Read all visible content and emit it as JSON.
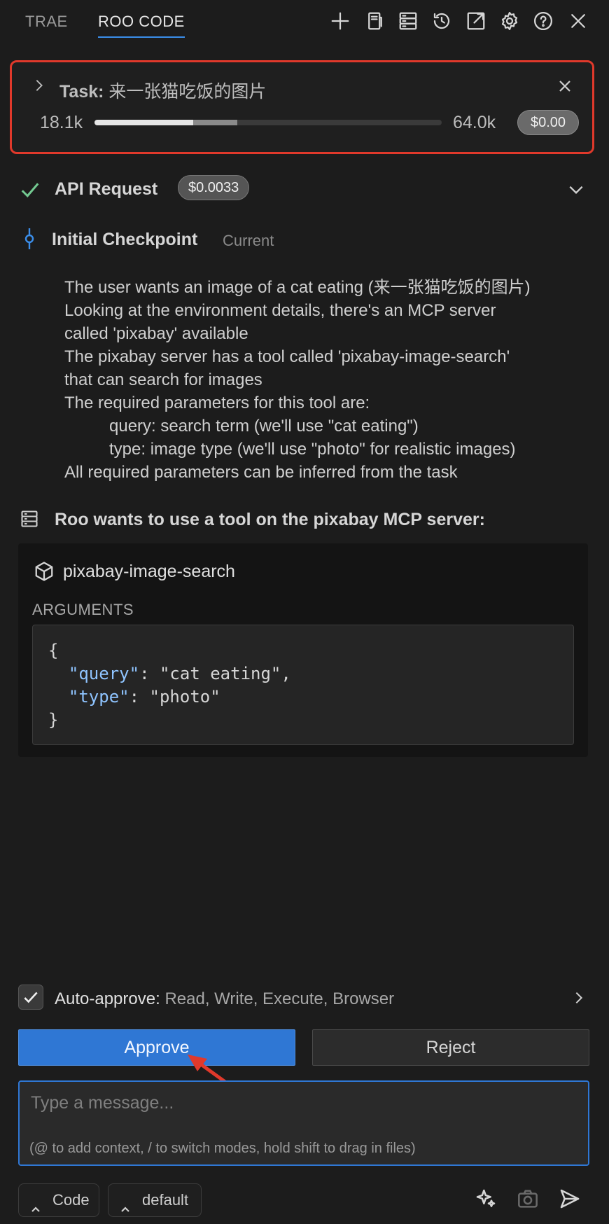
{
  "header": {
    "tabs": [
      {
        "label": "TRAE",
        "active": false
      },
      {
        "label": "ROO CODE",
        "active": true
      }
    ],
    "actions": [
      "plus-icon",
      "bookmark-icon",
      "server-icon",
      "history-icon",
      "external-link-icon",
      "gear-icon",
      "help-icon",
      "close-icon"
    ]
  },
  "task": {
    "prefix": "Task:",
    "title": "来一张猫吃饭的图片",
    "context_used": "18.1k",
    "context_max": "64.0k",
    "cost": "$0.00"
  },
  "api_request": {
    "label": "API Request",
    "cost": "$0.0033",
    "status_color": "#73c991"
  },
  "checkpoint": {
    "label": "Initial Checkpoint",
    "state": "Current"
  },
  "reasoning": {
    "lines": [
      {
        "text": "The user wants an image of a cat eating (来一张猫吃饭的图片)",
        "indent": false
      },
      {
        "text": "Looking at the environment details, there's an MCP server",
        "indent": false
      },
      {
        "text": "called 'pixabay' available",
        "indent": false
      },
      {
        "text": "The pixabay server has a tool called 'pixabay-image-search'",
        "indent": false
      },
      {
        "text": "that can search for images",
        "indent": false
      },
      {
        "text": "The required parameters for this tool are:",
        "indent": false
      },
      {
        "text": "query: search term (we'll use \"cat eating\")",
        "indent": true
      },
      {
        "text": "type: image type (we'll use \"photo\" for realistic images)",
        "indent": true
      },
      {
        "text": "All required parameters can be inferred from the task",
        "indent": false
      }
    ]
  },
  "mcp": {
    "header": "Roo wants to use a tool on the pixabay MCP server:",
    "tool_name": "pixabay-image-search",
    "arguments_label": "ARGUMENTS",
    "arguments": [
      {
        "key": "\"query\"",
        "value": "\"cat eating\"",
        "comma": ","
      },
      {
        "key": "\"type\"",
        "value": "\"photo\"",
        "comma": ""
      }
    ],
    "open_brace": "{",
    "close_brace": "}"
  },
  "auto_approve": {
    "label": "Auto-approve:",
    "value": "Read, Write, Execute, Browser",
    "checked": true
  },
  "buttons": {
    "approve": "Approve",
    "reject": "Reject"
  },
  "composer": {
    "placeholder": "Type a message...",
    "hint": "(@ to add context, / to switch modes, hold shift to drag in files)"
  },
  "footer": {
    "mode": "Code",
    "config": "default"
  },
  "colors": {
    "accent": "#2f77d4",
    "annotation": "#e0392b",
    "background": "#1c1c1c"
  }
}
